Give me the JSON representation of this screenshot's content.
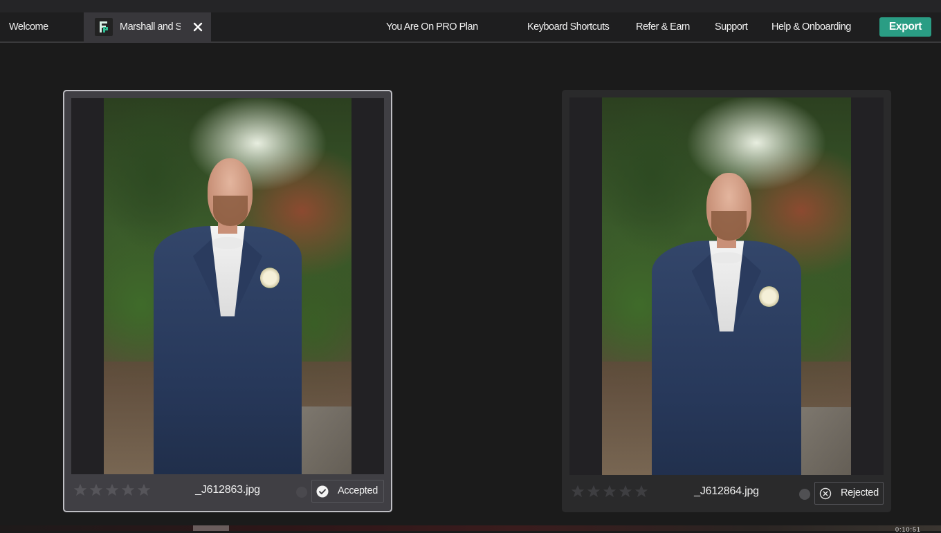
{
  "navbar": {
    "welcome_tab": "Welcome",
    "project_tab": {
      "title": "Marshall and S",
      "icon": "app-logo-icon",
      "close_icon": "close-icon"
    },
    "plan_label": "You Are On PRO Plan",
    "links": [
      "Keyboard Shortcuts",
      "Refer & Earn",
      "Support",
      "Help & Onboarding"
    ],
    "export_label": "Export",
    "accent_color": "#2a9d84"
  },
  "comparison": {
    "left": {
      "filename": "_J612863.jpg",
      "rating": 0,
      "max_rating": 5,
      "status": "Accepted",
      "status_icon": "check-circle-icon",
      "selected": true
    },
    "right": {
      "filename": "_J612864.jpg",
      "rating": 0,
      "max_rating": 5,
      "status": "Rejected",
      "status_icon": "x-circle-icon",
      "selected": false
    }
  },
  "footer": {
    "timecode": "0:10:51"
  }
}
